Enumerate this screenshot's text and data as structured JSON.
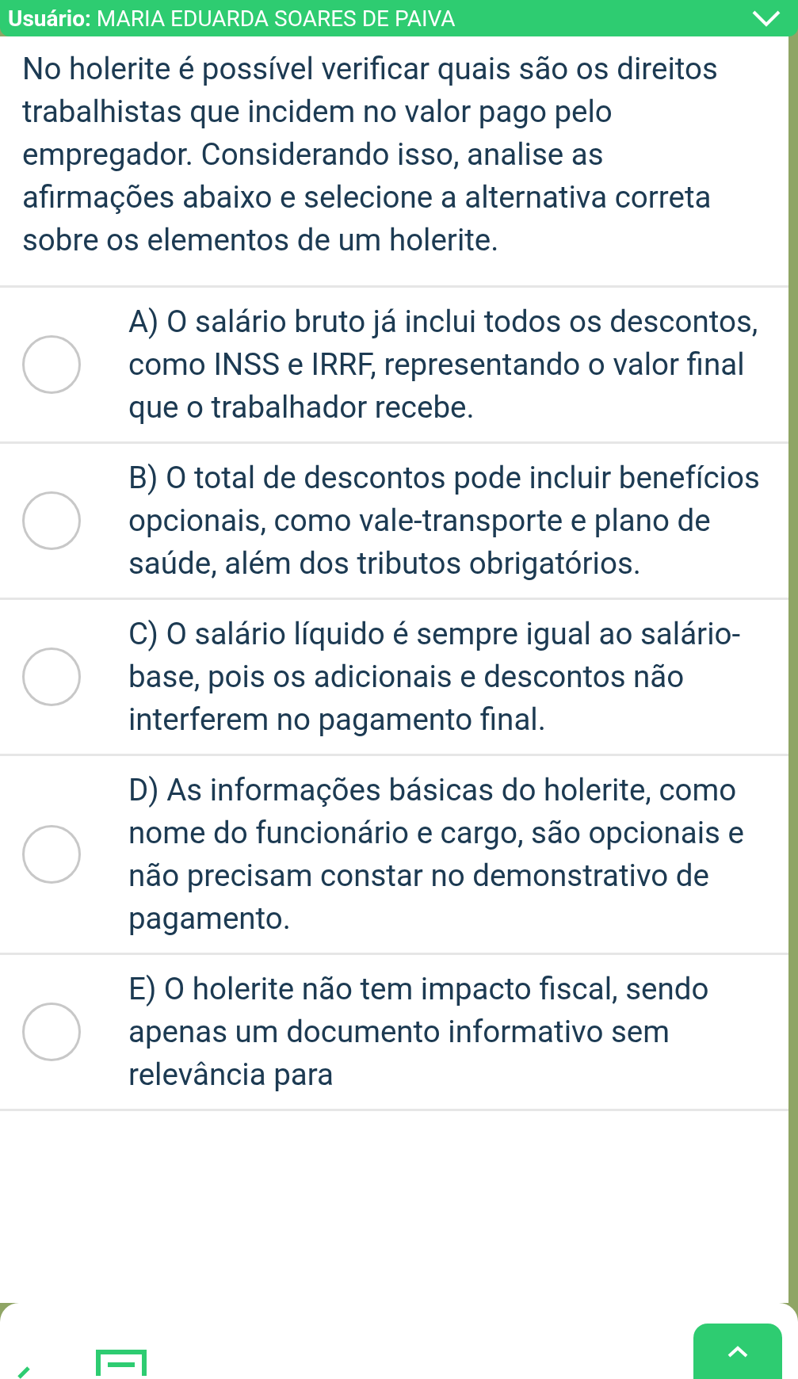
{
  "header": {
    "label": "Usuário:",
    "user_name": "MARIA EDUARDA SOARES DE PAIVA"
  },
  "question": "No holerite é possível verificar quais são os direitos trabalhistas que incidem no valor pago pelo empregador. Considerando isso, analise as afirmações abaixo e selecione a alternativa correta sobre os elementos de um holerite.",
  "options": [
    {
      "text": "A) O salário bruto já inclui todos os descontos, como INSS e IRRF, representando o valor final que o trabalhador recebe.",
      "selected": false
    },
    {
      "text": "B) O total de descontos pode incluir benefícios opcionais, como vale-transporte e plano de saúde, além dos tributos obrigatórios.",
      "selected": false
    },
    {
      "text": "C) O salário líquido é sempre igual ao salário-base, pois os adicionais e descontos não interferem no pagamento final.",
      "selected": false
    },
    {
      "text": "D) As informações básicas do holerite, como nome do funcionário e cargo, são opcionais e não precisam constar no demonstrativo de pagamento.",
      "selected": false
    },
    {
      "text": "E) O holerite não tem impacto fiscal, sendo apenas um documento informativo sem relevância para",
      "selected": false
    }
  ]
}
